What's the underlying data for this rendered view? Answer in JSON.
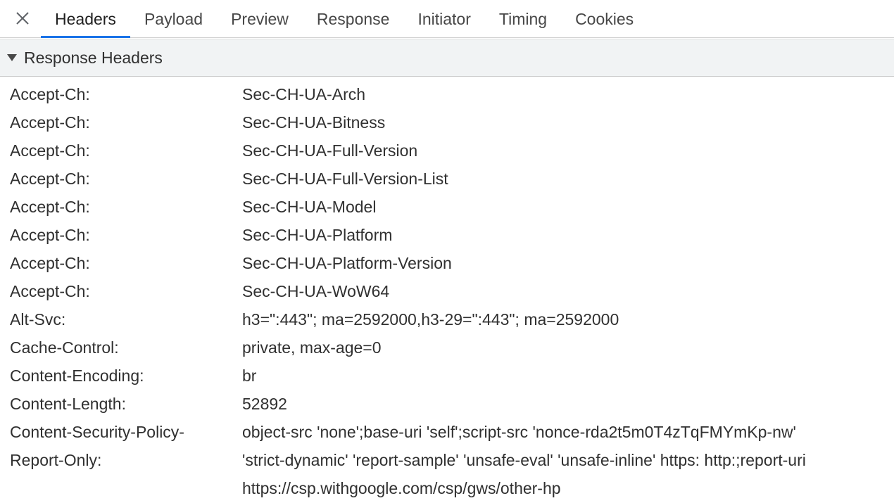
{
  "tabs": [
    {
      "label": "Headers",
      "active": true
    },
    {
      "label": "Payload",
      "active": false
    },
    {
      "label": "Preview",
      "active": false
    },
    {
      "label": "Response",
      "active": false
    },
    {
      "label": "Initiator",
      "active": false
    },
    {
      "label": "Timing",
      "active": false
    },
    {
      "label": "Cookies",
      "active": false
    }
  ],
  "close_icon": "close-icon",
  "section": {
    "title": "Response Headers",
    "expanded": true,
    "icon": "triangle-down-icon"
  },
  "headers": [
    {
      "name": "Accept-Ch:",
      "value": "Sec-CH-UA-Arch"
    },
    {
      "name": "Accept-Ch:",
      "value": "Sec-CH-UA-Bitness"
    },
    {
      "name": "Accept-Ch:",
      "value": "Sec-CH-UA-Full-Version"
    },
    {
      "name": "Accept-Ch:",
      "value": "Sec-CH-UA-Full-Version-List"
    },
    {
      "name": "Accept-Ch:",
      "value": "Sec-CH-UA-Model"
    },
    {
      "name": "Accept-Ch:",
      "value": "Sec-CH-UA-Platform"
    },
    {
      "name": "Accept-Ch:",
      "value": "Sec-CH-UA-Platform-Version"
    },
    {
      "name": "Accept-Ch:",
      "value": "Sec-CH-UA-WoW64"
    },
    {
      "name": "Alt-Svc:",
      "value": "h3=\":443\"; ma=2592000,h3-29=\":443\"; ma=2592000"
    },
    {
      "name": "Cache-Control:",
      "value": "private, max-age=0"
    },
    {
      "name": "Content-Encoding:",
      "value": "br"
    },
    {
      "name": "Content-Length:",
      "value": "52892"
    },
    {
      "name": "Content-Security-Policy-",
      "value": "object-src 'none';base-uri 'self';script-src 'nonce-rda2t5m0T4zTqFMYmKp-nw'"
    },
    {
      "name": "Report-Only:",
      "value": "'strict-dynamic' 'report-sample' 'unsafe-eval' 'unsafe-inline' https: http:;report-uri"
    },
    {
      "name": "",
      "value": "https://csp.withgoogle.com/csp/gws/other-hp"
    }
  ],
  "colors": {
    "accent": "#1a73e8",
    "section_bg": "#f1f3f4"
  }
}
